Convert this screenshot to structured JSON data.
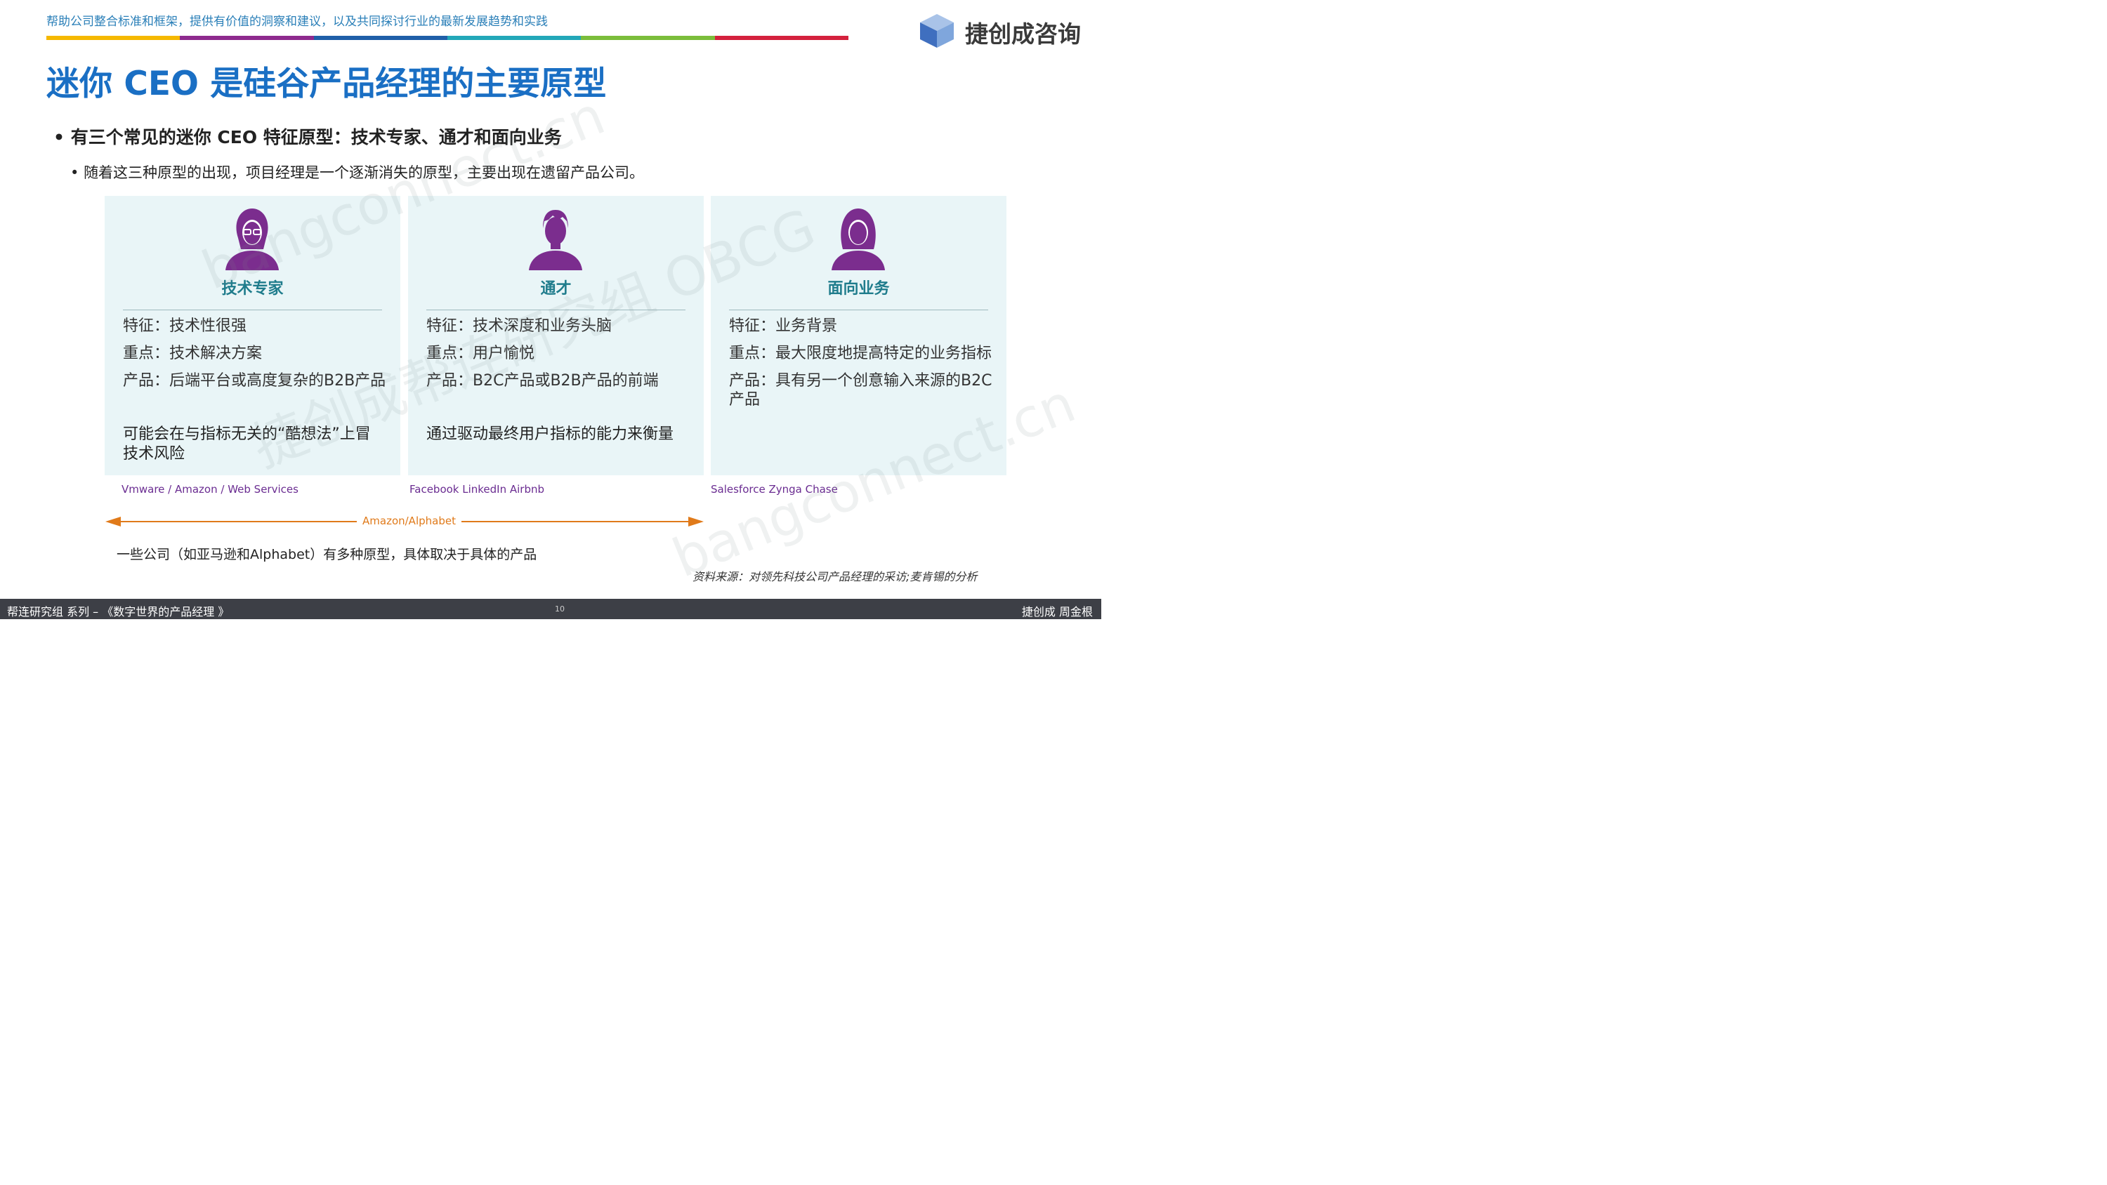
{
  "header": {
    "tagline": "帮助公司整合标准和框架，提供有价值的洞察和建议，以及共同探讨行业的最新发展趋势和实践",
    "color_bar": [
      "#f5b800",
      "#8e2a8e",
      "#1f5fa8",
      "#22a7b8",
      "#7bbd3b",
      "#d4213d"
    ],
    "logo_text": "捷创成咨询"
  },
  "title": "迷你 CEO 是硅谷产品经理的主要原型",
  "bullet_main": "有三个常见的迷你 CEO 特征原型：技术专家、通才和面向业务",
  "bullet_sub": "随着这三种原型的出现，项目经理是一个逐渐消失的原型，主要出现在遗留产品公司。",
  "panels": [
    {
      "avatar_icon": "woman-glasses-avatar-icon",
      "name": "技术专家",
      "rows": [
        "特征：技术性很强",
        "重点：技术解决方案",
        "产品：后端平台或高度复杂的B2B产品"
      ],
      "note": "可能会在与指标无关的“酷想法”上冒技术风险",
      "companies": "Vmware / Amazon  / Web Services"
    },
    {
      "avatar_icon": "man-avatar-icon",
      "name": "通才",
      "rows": [
        "特征：技术深度和业务头脑",
        "重点：用户愉悦",
        "产品：B2C产品或B2B产品的前端"
      ],
      "note": "通过驱动最终用户指标的能力来衡量",
      "companies": "Facebook   LinkedIn   Airbnb"
    },
    {
      "avatar_icon": "woman-avatar-icon",
      "name": "面向业务",
      "rows": [
        "特征：业务背景",
        "重点：最大限度地提高特定的业务指标",
        "产品：具有另一个创意输入来源的B2C产品"
      ],
      "note": "",
      "companies": "Salesforce  Zynga   Chase"
    }
  ],
  "arrow_label": "Amazon/Alphabet",
  "note": "一些公司（如亚马逊和Alphabet）有多种原型，具体取决于具体的产品",
  "source": "资料来源：对领先科技公司产品经理的采访;麦肯锡的分析",
  "footer": {
    "left": "帮连研究组 系列 – 《数字世界的产品经理 》",
    "page": "10",
    "right": "捷创成 周金根"
  },
  "watermarks": [
    "bangconnect.cn",
    "捷创成帮连研究组 OBCG",
    "bangconnect.cn"
  ],
  "colors": {
    "title": "#1a6fc4",
    "accent_purple": "#7b2d8e",
    "panel_bg": "#e9f5f7",
    "arrow": "#e07a1a"
  }
}
